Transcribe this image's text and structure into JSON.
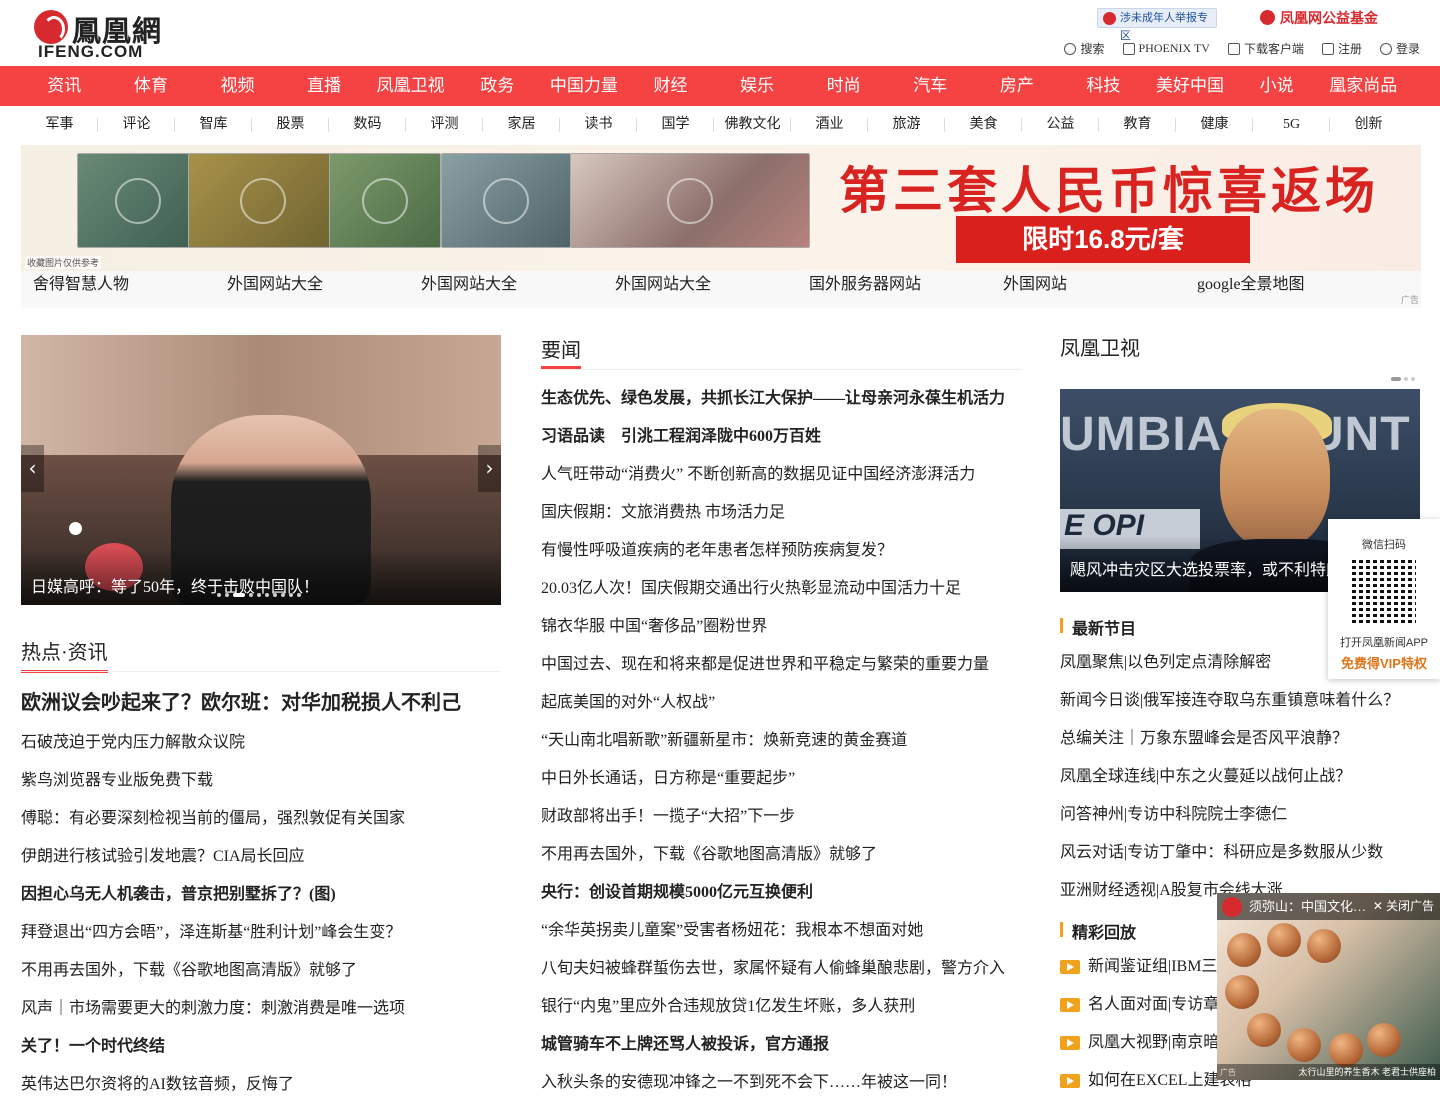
{
  "header": {
    "logo_cn": "鳳凰網",
    "logo_en": "IFENG.COM",
    "report_label": "涉未成年人举报专区",
    "fund_label": "凤凰网公益基金",
    "tools": [
      "搜索",
      "PHOENIX TV",
      "下载客户端",
      "注册",
      "登录"
    ]
  },
  "main_nav": [
    "资讯",
    "体育",
    "视频",
    "直播",
    "凤凰卫视",
    "政务",
    "中国力量",
    "财经",
    "娱乐",
    "时尚",
    "汽车",
    "房产",
    "科技",
    "美好中国",
    "小说",
    "凰家尚品"
  ],
  "sub_nav": [
    "军事",
    "评论",
    "智库",
    "股票",
    "数码",
    "评测",
    "家居",
    "读书",
    "国学",
    "佛教文化",
    "酒业",
    "旅游",
    "美食",
    "公益",
    "教育",
    "健康",
    "5G",
    "创新"
  ],
  "banner": {
    "headline": "第三套人民币惊喜返场",
    "price": "限时16.8元/套",
    "mini": "收藏图片仅供参考"
  },
  "ad_links": [
    "舍得智慧人物",
    "外国网站大全",
    "外国网站大全",
    "外国网站大全",
    "国外服务器网站",
    "外国网站",
    "google全景地图"
  ],
  "ad_tag": "广告",
  "slider": {
    "caption": "日媒高呼：等了50年，终于击败中国队！",
    "prev": "‹",
    "next": "›",
    "active_index": 2,
    "dot_count": 10
  },
  "hot": {
    "title": "热点·资讯",
    "items": [
      {
        "text": "欧洲议会吵起来了？欧尔班：对华加税损人不利己",
        "style": "big"
      },
      {
        "text": "石破茂迫于党内压力解散众议院",
        "style": ""
      },
      {
        "text": "紫鸟浏览器专业版免费下载",
        "style": ""
      },
      {
        "text": "傅聪：有必要深刻检视当前的僵局，强烈敦促有关国家",
        "style": ""
      },
      {
        "text": "伊朗进行核试验引发地震？CIA局长回应",
        "style": ""
      },
      {
        "text": "因担心乌无人机袭击，普京把别墅拆了？(图)",
        "style": "b"
      },
      {
        "text": "拜登退出“四方会晤”，泽连斯基“胜利计划”峰会生变？",
        "style": ""
      },
      {
        "text": "不用再去国外，下载《谷歌地图高清版》就够了",
        "style": ""
      },
      {
        "text": "风声｜市场需要更大的刺激力度：刺激消费是唯一选项",
        "style": ""
      },
      {
        "text": "关了！一个时代终结",
        "style": "b"
      },
      {
        "text": "英伟达巴尔资将的AI数铉音频，反悔了",
        "style": ""
      }
    ]
  },
  "news": {
    "title": "要闻",
    "items": [
      {
        "text": "生态优先、绿色发展，共抓长江大保护——让母亲河永葆生机活力",
        "style": "b"
      },
      {
        "text": "习语品读　引洮工程润泽陇中600万百姓",
        "style": "b"
      },
      {
        "text": "人气旺带动“消费火” 不断创新高的数据见证中国经济澎湃活力",
        "style": ""
      },
      {
        "text": "国庆假期：文旅消费热 市场活力足",
        "style": ""
      },
      {
        "text": "有慢性呼吸道疾病的老年患者怎样预防疾病复发？",
        "style": ""
      },
      {
        "text": "20.03亿人次！国庆假期交通出行火热彰显流动中国活力十足",
        "style": ""
      },
      {
        "text": "锦衣华服 中国“奢侈品”圈粉世界",
        "style": ""
      },
      {
        "text": "中国过去、现在和将来都是促进世界和平稳定与繁荣的重要力量",
        "style": ""
      },
      {
        "text": "起底美国的对外“人权战”",
        "style": ""
      },
      {
        "text": "“天山南北唱新歌”新疆新星市：焕新竞速的黄金赛道",
        "style": ""
      },
      {
        "text": "中日外长通话，日方称是“重要起步”",
        "style": ""
      },
      {
        "text": "财政部将出手！一揽子“大招”下一步",
        "style": ""
      },
      {
        "text": "不用再去国外，下载《谷歌地图高清版》就够了",
        "style": ""
      },
      {
        "text": "央行：创设首期规模5000亿元互换便利",
        "style": "b"
      },
      {
        "text": "“余华英拐卖儿童案”受害者杨妞花：我根本不想面对她",
        "style": ""
      },
      {
        "text": "八旬夫妇被蜂群蜇伤去世，家属怀疑有人偷蜂巢酿悲剧，警方介入",
        "style": ""
      },
      {
        "text": "银行“内鬼”里应外合违规放贷1亿发生坏账，多人获刑",
        "style": ""
      },
      {
        "text": "城管骑车不上牌还骂人被投诉，官方通报",
        "style": "b"
      },
      {
        "text": "入秋头条的安德现冲锋之一不到死不会下……年被这一同！",
        "style": ""
      }
    ]
  },
  "tv": {
    "title": "凤凰卫视",
    "image_board": "UMBIA COUNT",
    "image_board2": "E OPI",
    "caption": "飓风冲击灾区大选投票率，或不利特朗普",
    "programs_title": "最新节目",
    "programs": [
      "凤凰聚焦|以色列定点清除解密",
      "新闻今日谈|俄军接连夺取乌东重镇意味着什么？",
      "总编关注｜万象东盟峰会是否风平浪静？",
      "凤凰全球连线|中东之火蔓延以战何止战？",
      "问答神州|专访中科院院士李德仁",
      "风云对话|专访丁肇中：科研应是多数服从少数",
      "亚洲财经透视|A股复市会线大涨"
    ],
    "replay_title": "精彩回放",
    "replays": [
      "新闻鉴证组|IBM三十年",
      "名人面对面|专访章子怡",
      "凤凰大视野|南京暗战",
      "如何在EXCEL上建表格"
    ]
  },
  "qr": {
    "title": "微信扫码",
    "line1": "打开凤凰新闻APP",
    "line2": "免费得VIP特权"
  },
  "float_ad": {
    "title": "须弥山：中国文化…",
    "close": "关闭广告",
    "foot": "太行山里的养生香木 老君士供座柏",
    "ad": "广告"
  },
  "colors": {
    "brand_red": "#f54343",
    "accent_orange": "#f0a21d"
  }
}
